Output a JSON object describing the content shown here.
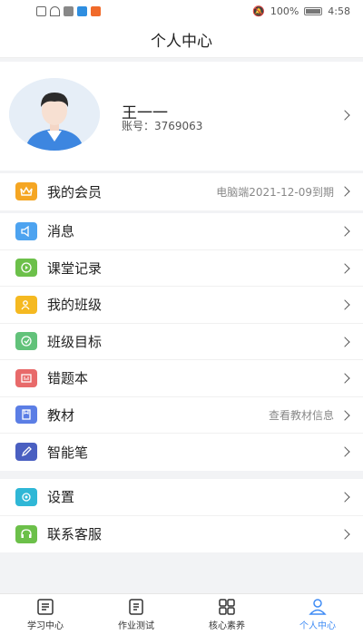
{
  "status_bar": {
    "battery": "100%",
    "time": "4:58"
  },
  "header": {
    "title": "个人中心"
  },
  "profile": {
    "name": "王一一",
    "account": "账号：3769063"
  },
  "membership": {
    "label": "我的会员",
    "value": "电脑端2021-12-09到期",
    "icon": "crown-icon",
    "color": "#f5a623"
  },
  "menu": [
    {
      "label": "消息",
      "icon": "speaker-icon",
      "color": "#4da3f0"
    },
    {
      "label": "课堂记录",
      "icon": "play-circle-icon",
      "color": "#6cc04a"
    },
    {
      "label": "我的班级",
      "icon": "class-icon",
      "color": "#f5b921"
    },
    {
      "label": "班级目标",
      "icon": "target-icon",
      "color": "#62c27a"
    },
    {
      "label": "错题本",
      "icon": "wrongbook-icon",
      "color": "#e86a6a"
    },
    {
      "label": "教材",
      "value": "查看教材信息",
      "icon": "book-icon",
      "color": "#5b7ee5"
    },
    {
      "label": "智能笔",
      "icon": "pen-icon",
      "color": "#4a5fc1"
    }
  ],
  "settings": [
    {
      "label": "设置",
      "icon": "gear-icon",
      "color": "#2fb7d6"
    },
    {
      "label": "联系客服",
      "icon": "headset-icon",
      "color": "#6cc04a"
    }
  ],
  "tabs": [
    {
      "label": "学习中心",
      "icon": "study-icon"
    },
    {
      "label": "作业测试",
      "icon": "homework-icon"
    },
    {
      "label": "核心素养",
      "icon": "grid-icon"
    },
    {
      "label": "个人中心",
      "icon": "person-icon",
      "active": true
    }
  ]
}
